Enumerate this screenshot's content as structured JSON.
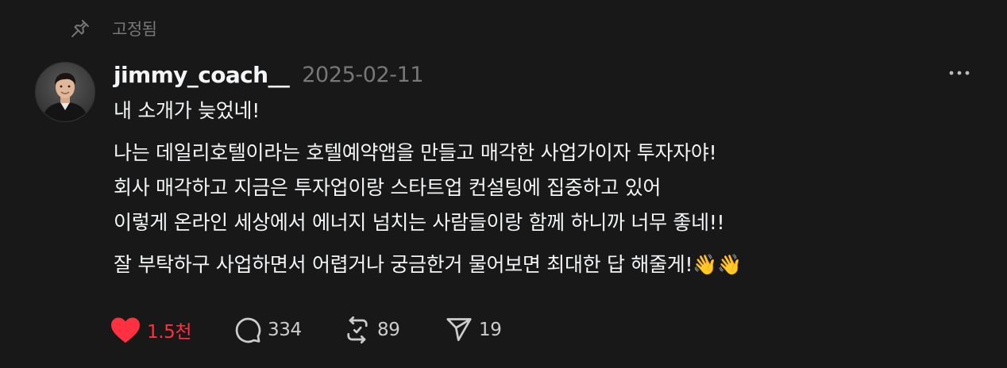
{
  "pinned": {
    "icon": "pin-icon",
    "label": "고정됨"
  },
  "post": {
    "author": {
      "username": "jimmy_coach__",
      "avatar": "avatar"
    },
    "date": "2025-02-11",
    "more_icon": "more-horizontal-icon",
    "paragraphs": [
      [
        "내 소개가 늦었네!"
      ],
      [
        "나는 데일리호텔이라는 호텔예약앱을 만들고 매각한 사업가이자 투자자야!",
        "회사 매각하고 지금은 투자업이랑 스타트업 컨설팅에 집중하고 있어",
        "이렇게 온라인 세상에서 에너지 넘치는 사람들이랑 함께 하니까 너무 좋네!!"
      ],
      [
        "잘 부탁하구 사업하면서 어렵거나 궁금한거 물어보면 최대한 답 해줄게!👋👋"
      ]
    ],
    "actions": {
      "like": {
        "icon": "heart-icon",
        "count": "1.5천",
        "liked": true,
        "color": "#ff3040"
      },
      "reply": {
        "icon": "comment-icon",
        "count": "334"
      },
      "repost": {
        "icon": "repost-icon",
        "count": "89"
      },
      "share": {
        "icon": "send-icon",
        "count": "19"
      }
    }
  },
  "colors": {
    "background": "#181818",
    "text": "#f3f5f7",
    "muted": "#777777",
    "like": "#ff3040"
  }
}
